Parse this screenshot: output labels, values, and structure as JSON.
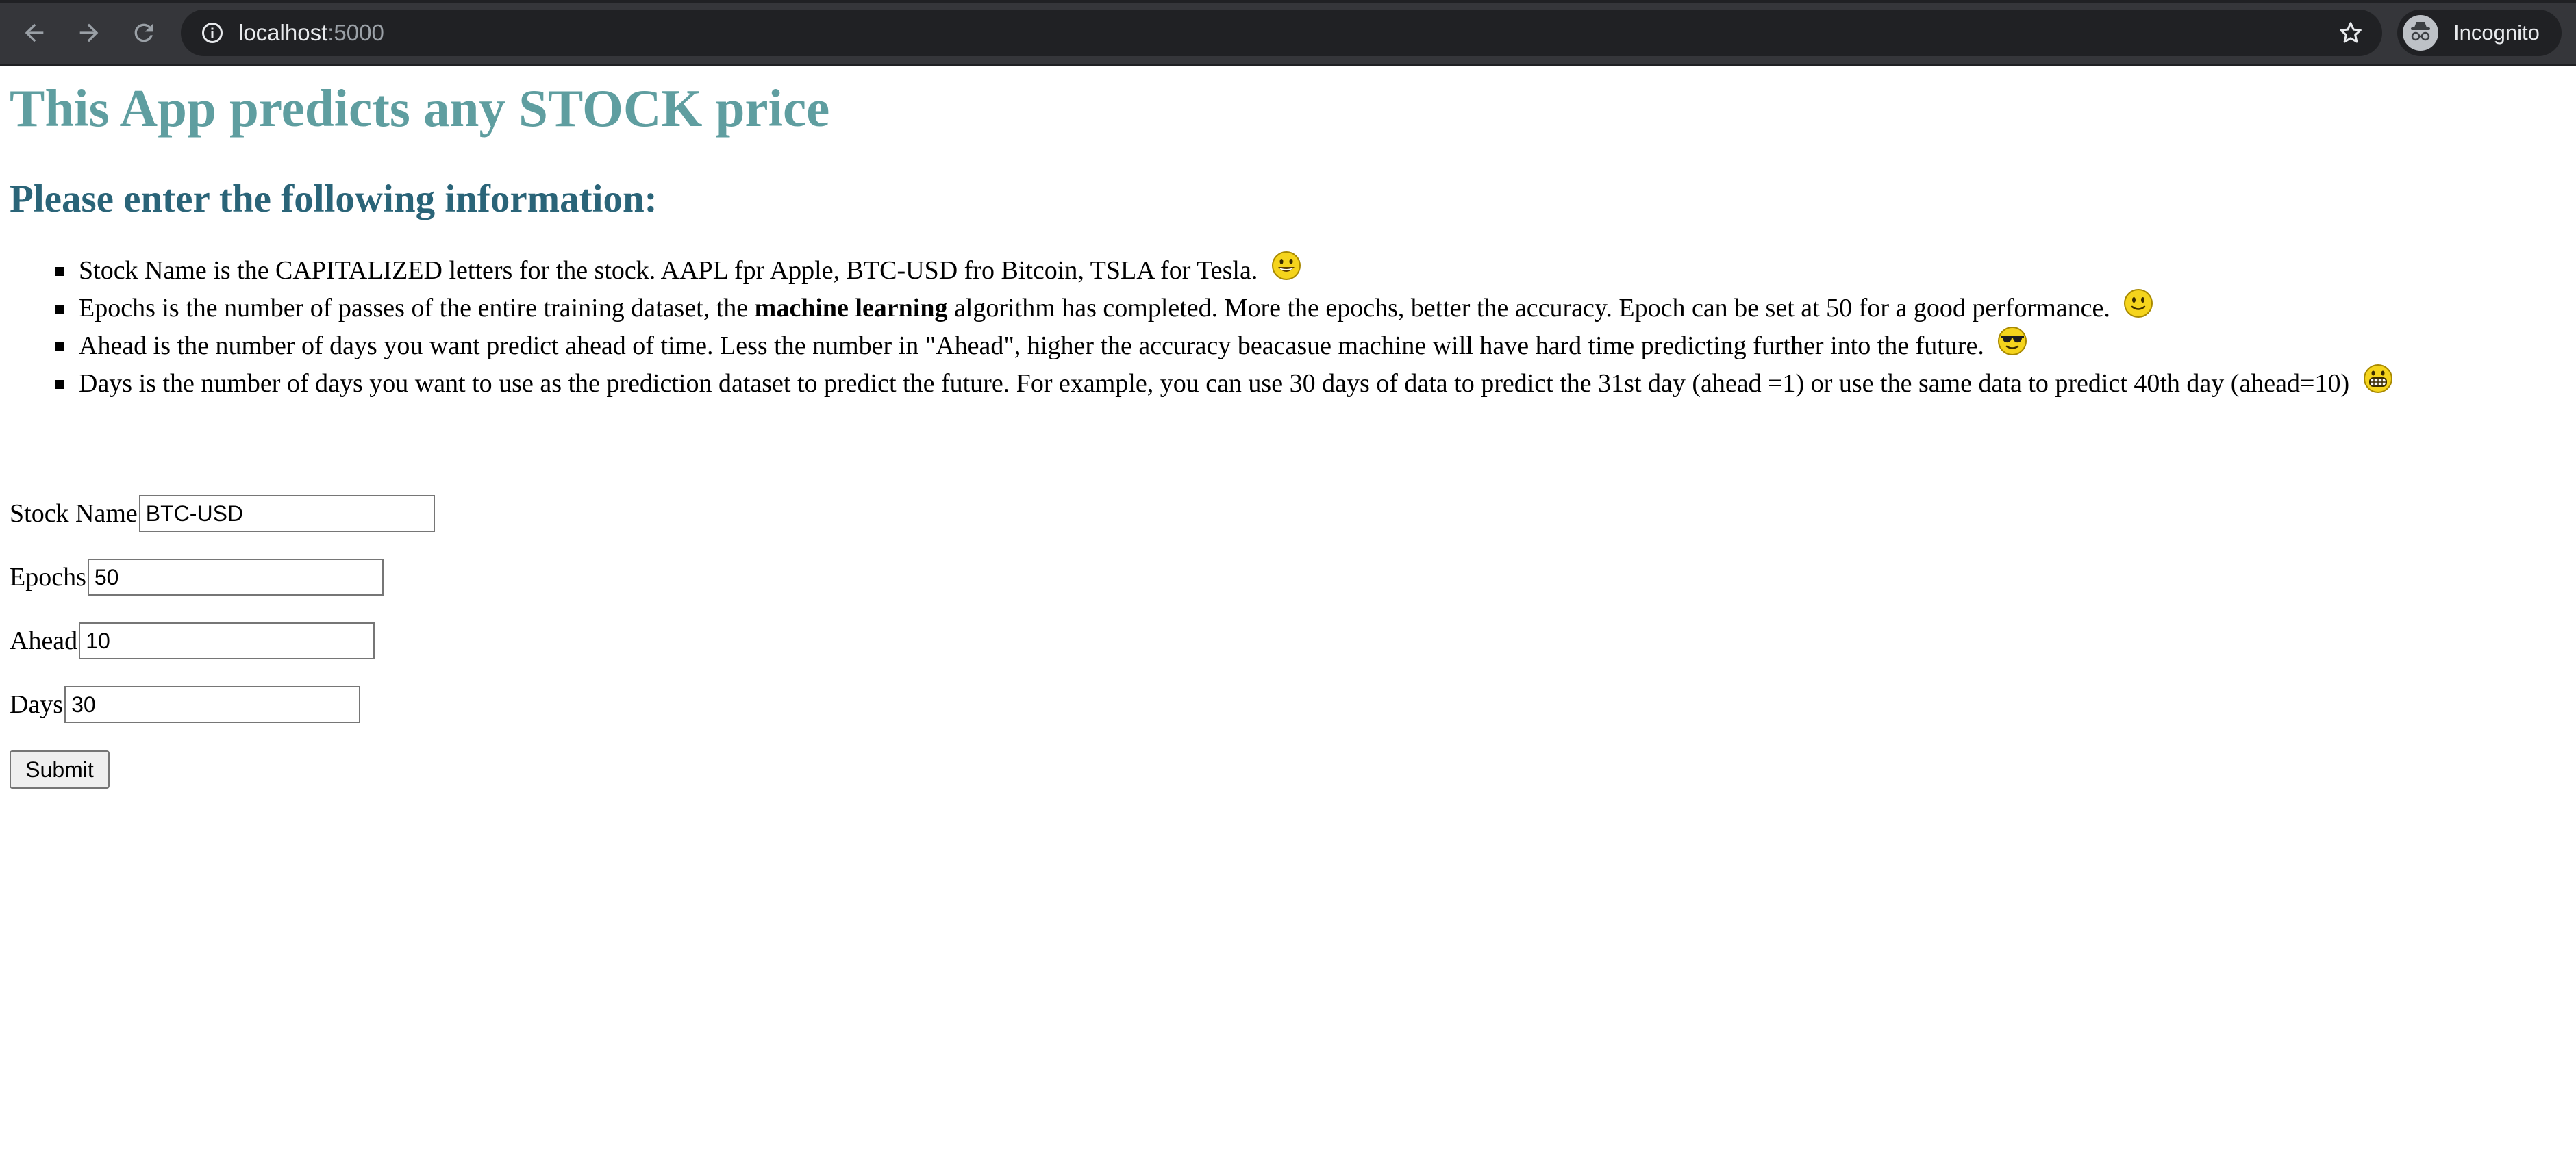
{
  "browser": {
    "url_host": "localhost",
    "url_port": ":5000",
    "profile_label": "Incognito",
    "icons": {
      "back": "arrow-left-icon",
      "forward": "arrow-right-icon",
      "reload": "reload-icon",
      "site_info": "info-icon",
      "bookmark": "star-icon",
      "profile": "incognito-icon"
    }
  },
  "page": {
    "title": "This App predicts any STOCK price",
    "subtitle": "Please enter the following information:",
    "bullets": [
      {
        "text": "Stock Name is the CAPITALIZED letters for the stock. AAPL fpr Apple, BTC-USD fro Bitcoin, TSLA for Tesla.",
        "emoji": "grinning-face-icon"
      },
      {
        "text_before": "Epochs is the number of passes of the entire training dataset, the ",
        "text_bold": "machine learning",
        "text_after": " algorithm has completed. More the epochs, better the accuracy. Epoch can be set at 50 for a good performance.",
        "emoji": "slightly-smiling-face-icon"
      },
      {
        "text": "Ahead is the number of days you want predict ahead of time. Less the number in \"Ahead\", higher the accuracy beacasue machine will have hard time predicting further into the future.",
        "emoji": "sunglasses-face-icon"
      },
      {
        "text": "Days is the number of days you want to use as the prediction dataset to predict the future. For example, you can use 30 days of data to predict the 31st day (ahead =1) or use the same data to predict 40th day (ahead=10)",
        "emoji": "grimacing-face-icon"
      }
    ],
    "form": {
      "stock_name": {
        "label": "Stock Name",
        "value": "BTC-USD"
      },
      "epochs": {
        "label": "Epochs",
        "value": "50"
      },
      "ahead": {
        "label": "Ahead",
        "value": "10"
      },
      "days": {
        "label": "Days",
        "value": "30"
      },
      "submit_label": "Submit"
    }
  }
}
